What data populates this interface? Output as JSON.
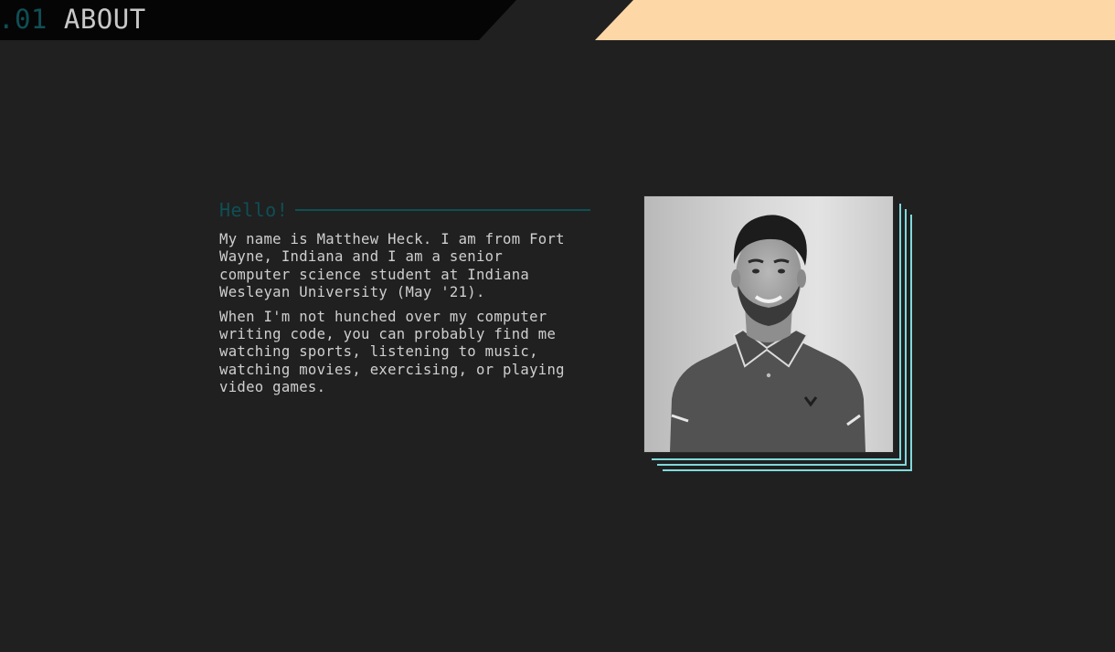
{
  "header": {
    "section_number": ".01",
    "section_title": "ABOUT"
  },
  "about": {
    "greeting": "Hello!",
    "paragraph_1_lines": [
      "My name is Matthew Heck. I am from Fort",
      "Wayne, Indiana and I am a senior",
      "computer science student at Indiana",
      "Wesleyan University (May '21)."
    ],
    "paragraph_2_lines": [
      "When I'm not hunched over my computer",
      "writing code, you can probably find me",
      "watching sports, listening to music,",
      "watching movies, exercising, or playing",
      "video games."
    ]
  },
  "photo": {
    "subject": "portrait-photo"
  },
  "colors": {
    "background": "#202020",
    "header_bar": "#050505",
    "accent_peach": "#fdd7a6",
    "accent_teal_dark": "#0f4f55",
    "frame_teal": "#7fd9dc",
    "text": "#cfcfcf"
  }
}
